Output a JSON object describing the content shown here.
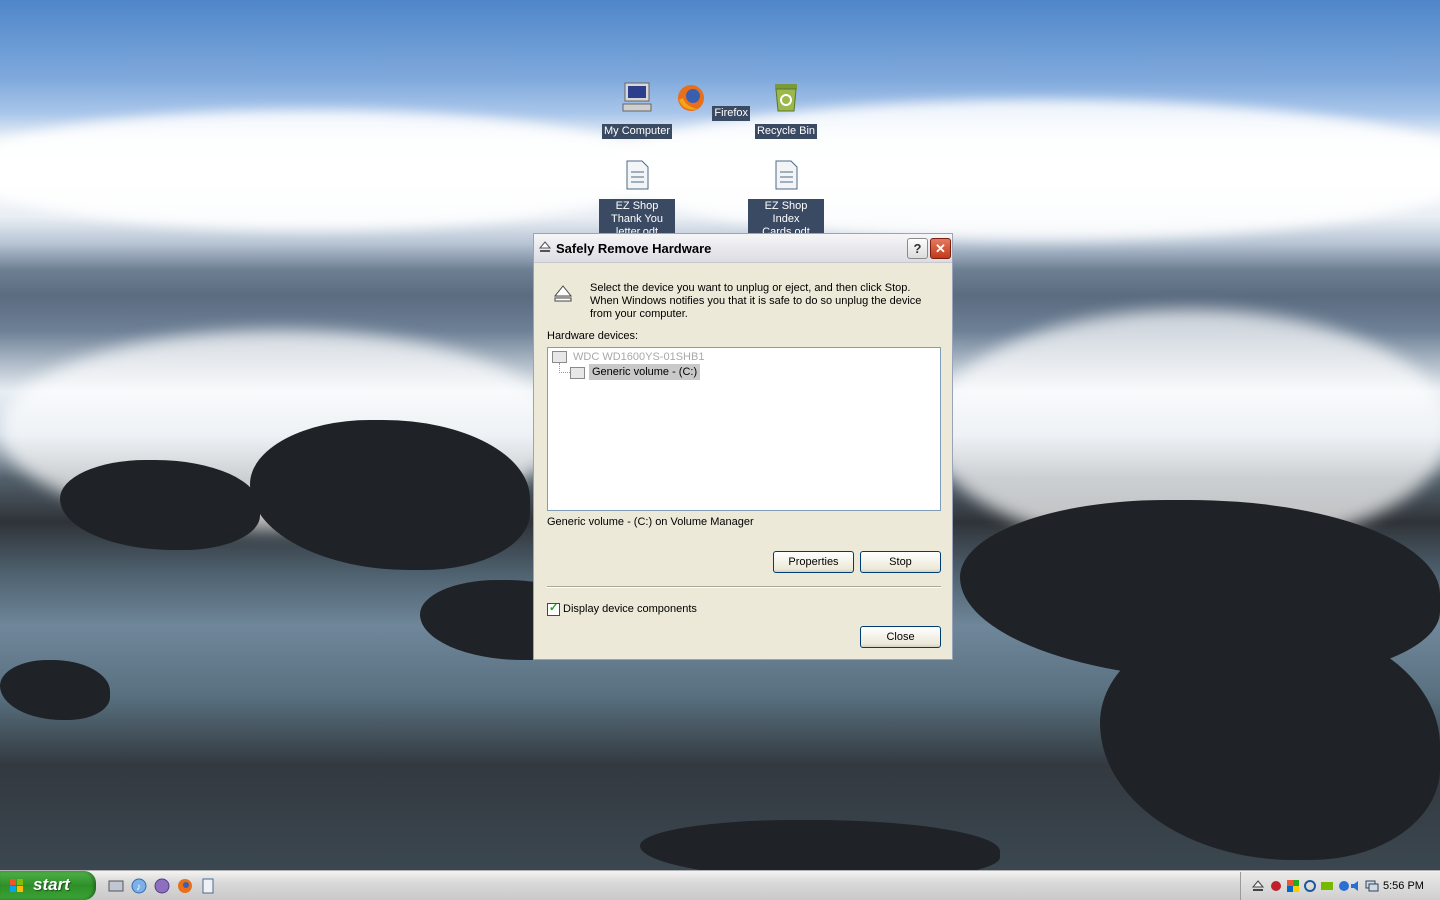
{
  "desktop": {
    "icons": [
      {
        "label": "My Computer"
      },
      {
        "label": "Firefox"
      },
      {
        "label": "Recycle Bin"
      },
      {
        "label": "EZ Shop Thank You letter.odt"
      },
      {
        "label": "EZ Shop Index Cards.odt"
      }
    ]
  },
  "dialog": {
    "title": "Safely Remove Hardware",
    "help_label": "?",
    "close_label": "✕",
    "instructions": "Select the device you want to unplug or eject, and then click Stop. When Windows notifies you that it is safe to do so unplug the device from your computer.",
    "hardware_label": "Hardware devices:",
    "devices": [
      {
        "label": "WDC WD1600YS-01SHB1"
      },
      {
        "label": "Generic volume - (C:)"
      }
    ],
    "description": "Generic volume - (C:) on Volume Manager",
    "properties_label": "Properties",
    "stop_label": "Stop",
    "checkbox_label": "Display device components",
    "checkbox_checked": true,
    "close_button_label": "Close"
  },
  "taskbar": {
    "start_label": "start",
    "clock": "5:56 PM"
  },
  "colors": {
    "dialog_bg": "#ece9d8",
    "start_green": "#3aa534",
    "selection": "#c9c9c9"
  }
}
